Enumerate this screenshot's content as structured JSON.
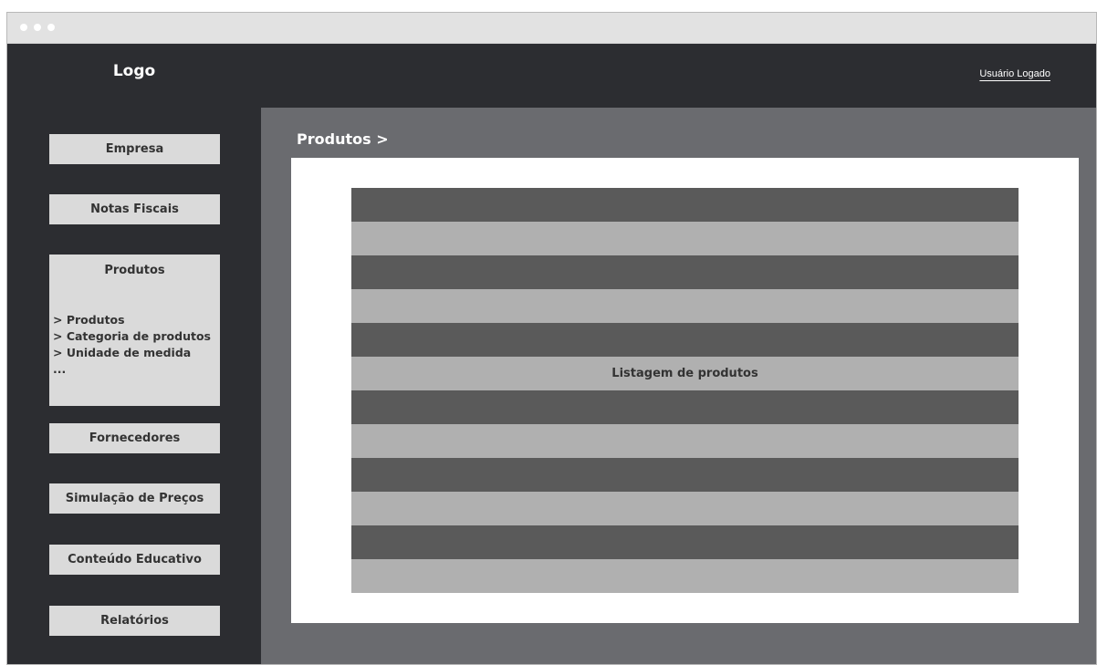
{
  "header": {
    "logo": "Logo",
    "user": "Usuário Logado"
  },
  "sidebar": {
    "items": [
      {
        "label": "Empresa"
      },
      {
        "label": "Notas Fiscais"
      },
      {
        "label": "Produtos",
        "submenu": [
          "> Produtos",
          "> Categoria de produtos",
          "> Unidade de medida",
          "..."
        ]
      },
      {
        "label": "Fornecedores"
      },
      {
        "label": "Simulação de Preços"
      },
      {
        "label": "Conteúdo Educativo"
      },
      {
        "label": "Relatórios"
      }
    ]
  },
  "main": {
    "breadcrumb": "Produtos >",
    "table_label": "Listagem de produtos"
  }
}
